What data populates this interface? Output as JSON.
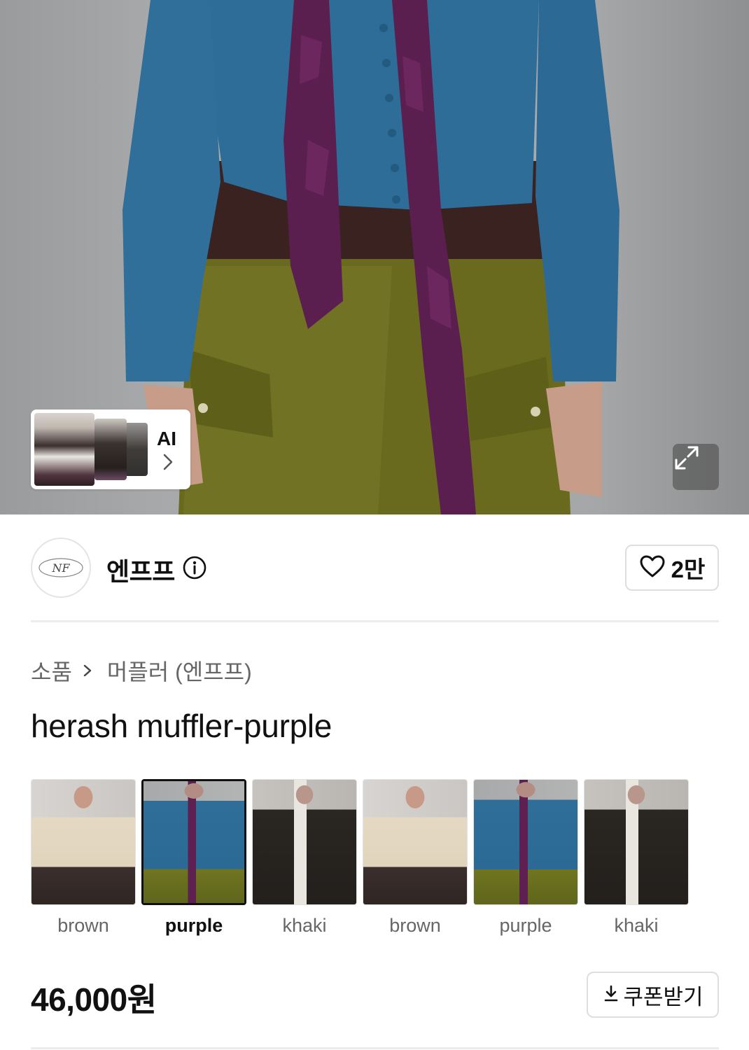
{
  "hero": {
    "ai_chip_label": "AI",
    "expand_label": ""
  },
  "brand": {
    "name": "엔프프",
    "likes": "2만"
  },
  "breadcrumb": {
    "category": "소품",
    "subcategory": "머플러 (엔프프)"
  },
  "product": {
    "title": "herash muffler-purple",
    "price": "46,000원"
  },
  "variants": [
    {
      "label": "brown",
      "look": "brown",
      "selected": false
    },
    {
      "label": "purple",
      "look": "purple",
      "selected": true
    },
    {
      "label": "khaki",
      "look": "khaki",
      "selected": false
    },
    {
      "label": "brown",
      "look": "brown",
      "selected": false
    },
    {
      "label": "purple",
      "look": "purple",
      "selected": false
    },
    {
      "label": "khaki",
      "look": "khaki",
      "selected": false
    }
  ],
  "coupon": {
    "label": "쿠폰받기"
  },
  "icons": {
    "info": "info-icon",
    "heart": "heart-icon",
    "download": "download-icon",
    "expand": "expand-icon",
    "chevron": "chevron-right-icon"
  }
}
